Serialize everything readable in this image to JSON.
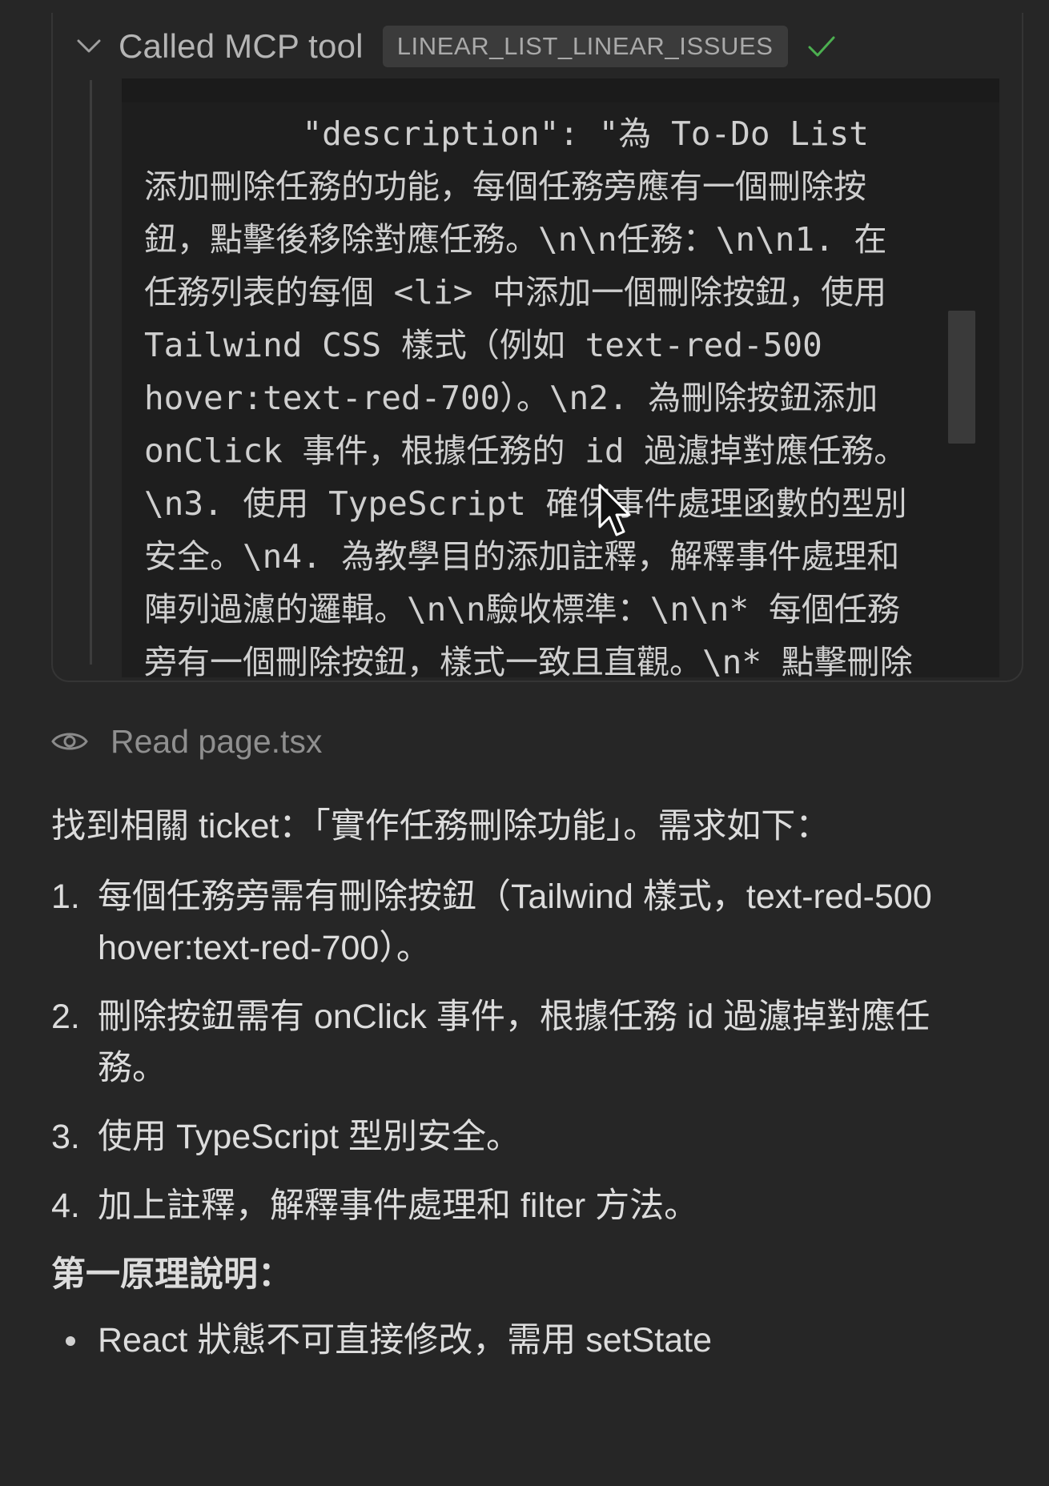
{
  "tool_call": {
    "title": "Called MCP tool",
    "tool_name": "LINEAR_LIST_LINEAR_ISSUES",
    "status": "success",
    "code_lines": [
      "        \"description\": \"為 To-Do List",
      "添加刪除任務的功能，每個任務旁應有一個刪除按",
      "鈕，點擊後移除對應任務。\\n\\n任務：\\n\\n1. 在",
      "任務列表的每個 <li> 中添加一個刪除按鈕，使用",
      "Tailwind CSS 樣式（例如 text-red-500",
      "hover:text-red-700）。\\n2. 為刪除按鈕添加",
      "onClick 事件，根據任務的 id 過濾掉對應任務。",
      "\\n3. 使用 TypeScript 確保事件處理函數的型別",
      "安全。\\n4. 為教學目的添加註釋，解釋事件處理和",
      "陣列過濾的邏輯。\\n\\n驗收標準：\\n\\n* 每個任務",
      "旁有一個刪除按鈕，樣式一致且直觀。\\n* 點擊刪除"
    ]
  },
  "read_action": {
    "label": "Read page.tsx"
  },
  "response": {
    "intro": "找到相關 ticket：「實作任務刪除功能」。需求如下：",
    "requirements": [
      {
        "num": "1.",
        "text": "每個任務旁需有刪除按鈕（Tailwind 樣式，text-red-500 hover:text-red-700）。"
      },
      {
        "num": "2.",
        "text": "刪除按鈕需有 onClick 事件，根據任務 id 過濾掉對應任務。"
      },
      {
        "num": "3.",
        "text": "使用 TypeScript 型別安全。"
      },
      {
        "num": "4.",
        "text": "加上註釋，解釋事件處理和 filter 方法。"
      }
    ],
    "section_title": "第一原理說明：",
    "bullets": [
      "React 狀態不可直接修改，需用 setState"
    ]
  },
  "colors": {
    "background": "#262626",
    "code_background": "#1e1e1e",
    "success": "#4caf50"
  }
}
